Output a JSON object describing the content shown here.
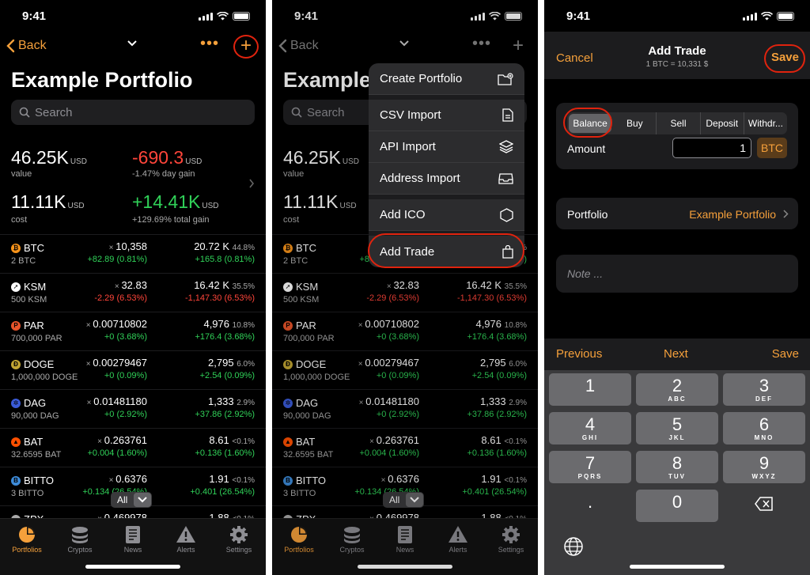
{
  "status": {
    "time": "9:41"
  },
  "portfolio": {
    "back": "Back",
    "title": "Example Portfolio",
    "search_placeholder": "Search",
    "value": "46.25K",
    "value_unit": "USD",
    "value_label": "value",
    "day_gain": "-690.3",
    "day_gain_unit": "USD",
    "day_gain_label": "-1.47% day gain",
    "cost": "11.11K",
    "cost_unit": "USD",
    "cost_label": "cost",
    "total_gain": "+14.41K",
    "total_gain_unit": "USD",
    "total_gain_label": "+129.69% total gain",
    "filter": "All"
  },
  "coins": [
    {
      "sym": "BTC",
      "hold": "2 BTC",
      "price": "10,358",
      "pchg": "+82.89 (0.81%)",
      "val": "20.72 K",
      "pct": "44.8%",
      "vchg": "+165.8 (0.81%)",
      "up": true,
      "color": "#f7931a",
      "glyph": "₿"
    },
    {
      "sym": "KSM",
      "hold": "500 KSM",
      "price": "32.83",
      "pchg": "-2.29 (6.53%)",
      "val": "16.42 K",
      "pct": "35.5%",
      "vchg": "-1,147.30 (6.53%)",
      "up": false,
      "color": "#ffffff",
      "glyph": "➚"
    },
    {
      "sym": "PAR",
      "hold": "700,000 PAR",
      "price": "0.00710802",
      "pchg": "+0 (3.68%)",
      "val": "4,976",
      "pct": "10.8%",
      "vchg": "+176.4 (3.68%)",
      "up": true,
      "color": "#e8542a",
      "glyph": "P"
    },
    {
      "sym": "DOGE",
      "hold": "1,000,000 DOGE",
      "price": "0.00279467",
      "pchg": "+0 (0.09%)",
      "val": "2,795",
      "pct": "6.0%",
      "vchg": "+2.54 (0.09%)",
      "up": true,
      "color": "#c2a633",
      "glyph": "Ð"
    },
    {
      "sym": "DAG",
      "hold": "90,000 DAG",
      "price": "0.01481180",
      "pchg": "+0 (2.92%)",
      "val": "1,333",
      "pct": "2.9%",
      "vchg": "+37.86 (2.92%)",
      "up": true,
      "color": "#3a5bd9",
      "glyph": "✲"
    },
    {
      "sym": "BAT",
      "hold": "32.6595 BAT",
      "price": "0.263761",
      "pchg": "+0.004 (1.60%)",
      "val": "8.61",
      "pct": "<0.1%",
      "vchg": "+0.136 (1.60%)",
      "up": true,
      "color": "#ff5000",
      "glyph": "▲"
    },
    {
      "sym": "BITTO",
      "hold": "3 BITTO",
      "price": "0.6376",
      "pchg": "+0.134 (26.54%)",
      "val": "1.91",
      "pct": "<0.1%",
      "vchg": "+0.401 (26.54%)",
      "up": true,
      "color": "#3d8bd9",
      "glyph": "B"
    },
    {
      "sym": "ZPX",
      "hold": "",
      "price": "0.469978",
      "pchg": "",
      "val": "1.88",
      "pct": "<0.1%",
      "vchg": "",
      "up": true,
      "color": "#aaaaaa",
      "glyph": "●"
    }
  ],
  "tabs": [
    {
      "label": "Portfolios",
      "icon": "pie-chart-icon"
    },
    {
      "label": "Cryptos",
      "icon": "coins-icon"
    },
    {
      "label": "News",
      "icon": "newspaper-icon"
    },
    {
      "label": "Alerts",
      "icon": "alert-icon"
    },
    {
      "label": "Settings",
      "icon": "gear-icon"
    }
  ],
  "menu": {
    "create": "Create Portfolio",
    "csv": "CSV Import",
    "api": "API Import",
    "address": "Address Import",
    "ico": "Add ICO",
    "trade": "Add Trade"
  },
  "trade": {
    "cancel": "Cancel",
    "title": "Add Trade",
    "subtitle": "1 BTC = 10,331 $",
    "save": "Save",
    "segments": [
      "Balance",
      "Buy",
      "Sell",
      "Deposit",
      "Withdr..."
    ],
    "amount_label": "Amount",
    "amount_value": "1",
    "currency": "BTC",
    "portfolio_label": "Portfolio",
    "portfolio_value": "Example Portfolio",
    "note_placeholder": "Note ...",
    "previous": "Previous",
    "next": "Next",
    "save_bar": "Save"
  },
  "keypad": [
    {
      "n": "1",
      "l": ""
    },
    {
      "n": "2",
      "l": "ABC"
    },
    {
      "n": "3",
      "l": "DEF"
    },
    {
      "n": "4",
      "l": "GHI"
    },
    {
      "n": "5",
      "l": "JKL"
    },
    {
      "n": "6",
      "l": "MNO"
    },
    {
      "n": "7",
      "l": "PQRS"
    },
    {
      "n": "8",
      "l": "TUV"
    },
    {
      "n": "9",
      "l": "WXYZ"
    },
    {
      "n": ".",
      "l": ""
    },
    {
      "n": "0",
      "l": ""
    }
  ],
  "colors": {
    "accent": "#f5a03b",
    "up": "#30d158",
    "down": "#ff453a",
    "highlight": "#e0230e"
  }
}
